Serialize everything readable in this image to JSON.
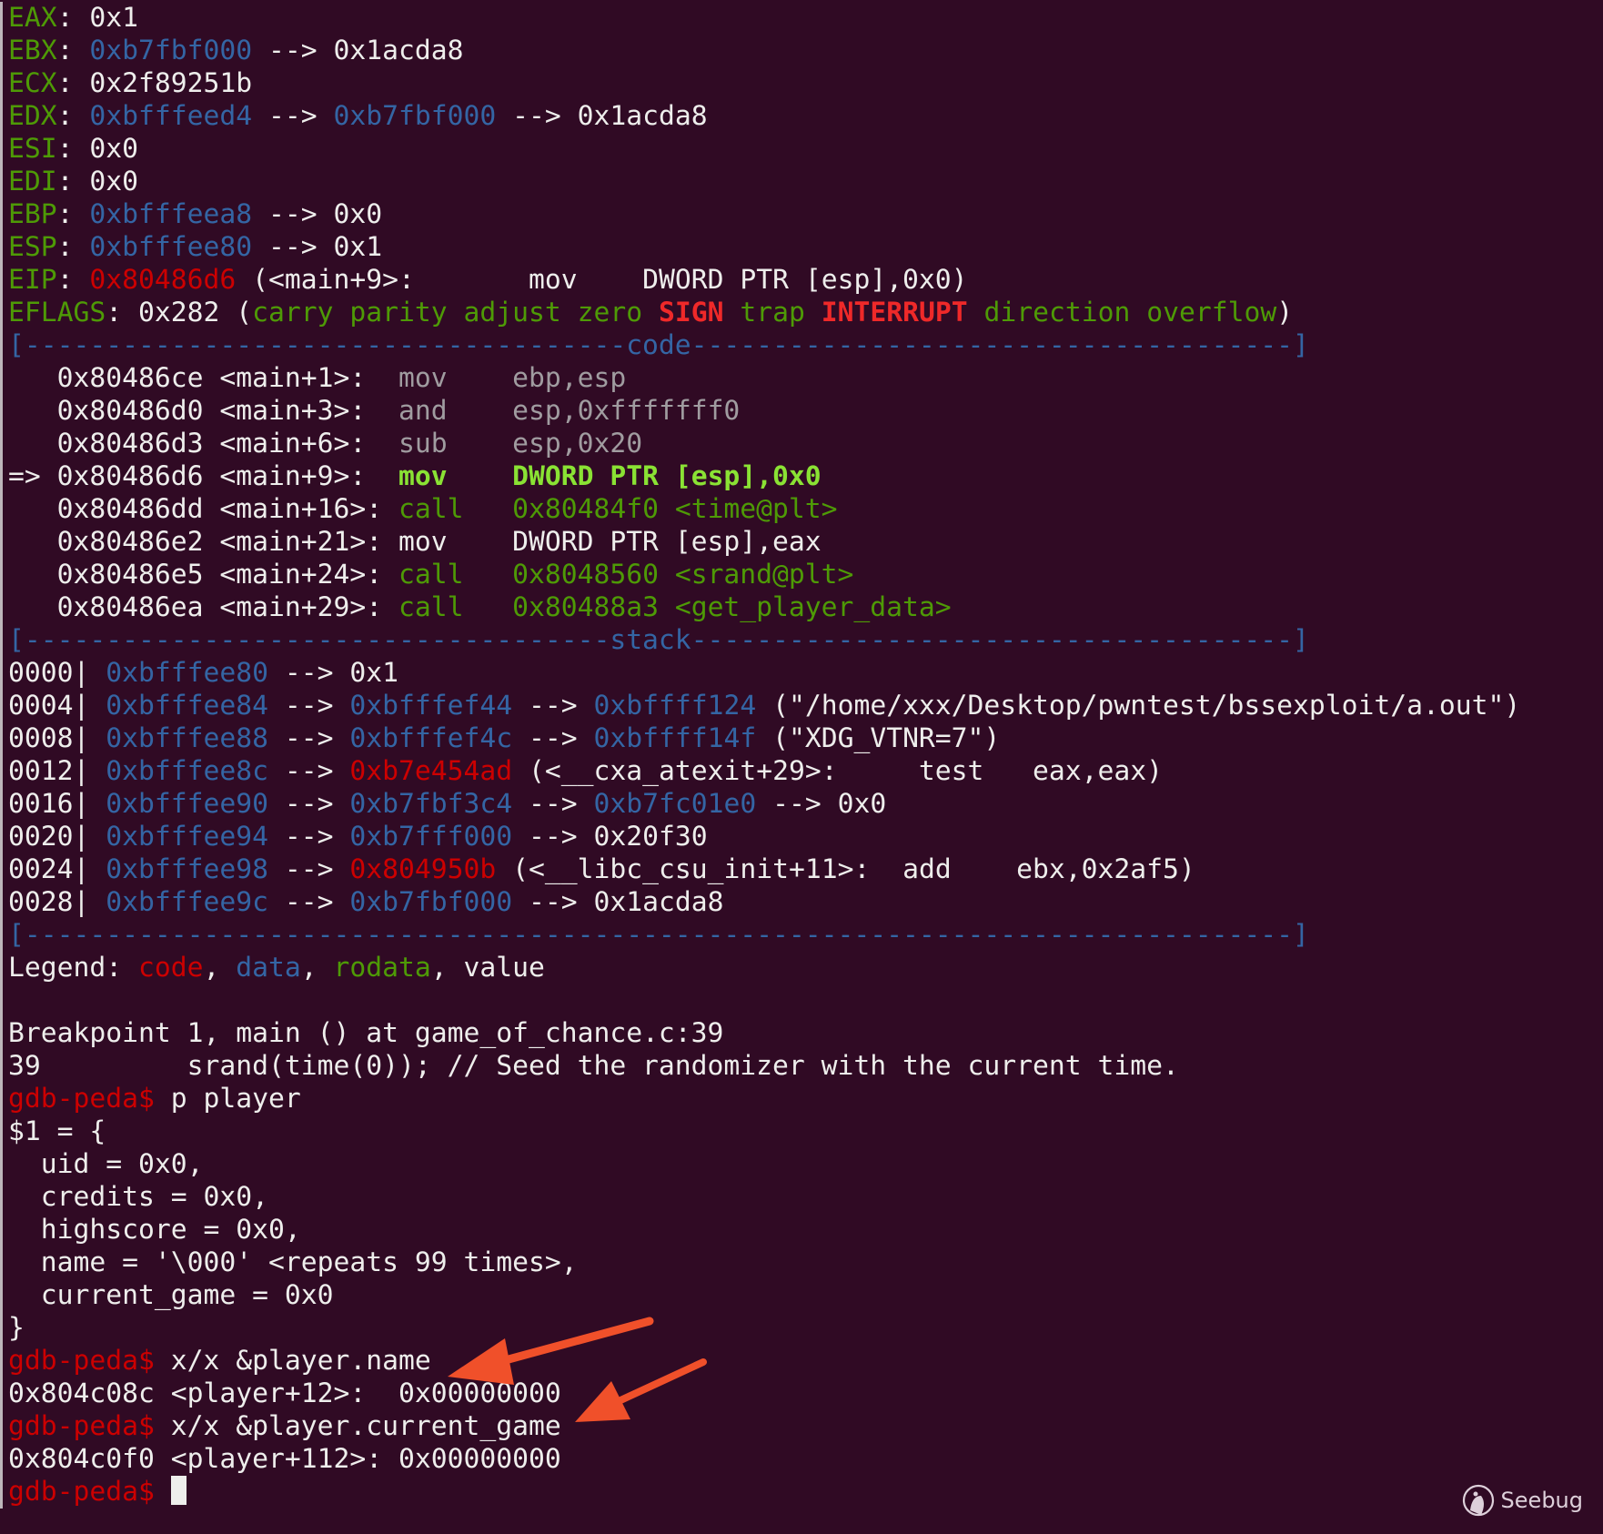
{
  "colors": {
    "background": "#300a24",
    "green": "#4e9a06",
    "blue": "#3465a4",
    "red": "#cc0000",
    "bright_red": "#ef2929",
    "bright_green": "#8ae234",
    "white": "#eeeeec",
    "arrow": "#f0502a"
  },
  "sections": [
    {
      "name": "registers-panel",
      "lines": [
        [
          {
            "t": "EAX",
            "c": "g"
          },
          {
            "t": ": 0x1",
            "c": "w"
          }
        ],
        [
          {
            "t": "EBX",
            "c": "g"
          },
          {
            "t": ": ",
            "c": "w"
          },
          {
            "t": "0xb7fbf000",
            "c": "b"
          },
          {
            "t": " --> 0x1acda8",
            "c": "w"
          }
        ],
        [
          {
            "t": "ECX",
            "c": "g"
          },
          {
            "t": ": 0x2f89251b",
            "c": "w"
          }
        ],
        [
          {
            "t": "EDX",
            "c": "g"
          },
          {
            "t": ": ",
            "c": "w"
          },
          {
            "t": "0xbfffeed4",
            "c": "b"
          },
          {
            "t": " --> ",
            "c": "w"
          },
          {
            "t": "0xb7fbf000",
            "c": "b"
          },
          {
            "t": " --> 0x1acda8",
            "c": "w"
          }
        ],
        [
          {
            "t": "ESI",
            "c": "g"
          },
          {
            "t": ": 0x0",
            "c": "w"
          }
        ],
        [
          {
            "t": "EDI",
            "c": "g"
          },
          {
            "t": ": 0x0",
            "c": "w"
          }
        ],
        [
          {
            "t": "EBP",
            "c": "g"
          },
          {
            "t": ": ",
            "c": "w"
          },
          {
            "t": "0xbfffeea8",
            "c": "b"
          },
          {
            "t": " --> 0x0",
            "c": "w"
          }
        ],
        [
          {
            "t": "ESP",
            "c": "g"
          },
          {
            "t": ": ",
            "c": "w"
          },
          {
            "t": "0xbfffee80",
            "c": "b"
          },
          {
            "t": " --> 0x1",
            "c": "w"
          }
        ],
        [
          {
            "t": "EIP",
            "c": "g"
          },
          {
            "t": ": ",
            "c": "w"
          },
          {
            "t": "0x80486d6",
            "c": "r"
          },
          {
            "t": " (<main+9>:       mov    DWORD PTR [esp],0x0)",
            "c": "w"
          }
        ],
        [
          {
            "t": "EFLAGS",
            "c": "g"
          },
          {
            "t": ": 0x282 (",
            "c": "w"
          },
          {
            "t": "carry parity adjust zero ",
            "c": "g"
          },
          {
            "t": "SIGN",
            "c": "R"
          },
          {
            "t": " trap ",
            "c": "g"
          },
          {
            "t": "INTERRUPT",
            "c": "R"
          },
          {
            "t": " direction overflow",
            "c": "g"
          },
          {
            "t": ")",
            "c": "w"
          }
        ]
      ]
    },
    {
      "name": "code-panel",
      "lines": [
        [
          {
            "t": "[-------------------------------------code-------------------------------------]",
            "c": "s"
          }
        ],
        [
          {
            "t": "   0x80486ce <main+1>:  ",
            "c": "w"
          },
          {
            "t": "mov    ebp,esp",
            "c": "d"
          }
        ],
        [
          {
            "t": "   0x80486d0 <main+3>:  ",
            "c": "w"
          },
          {
            "t": "and    esp,0xfffffff0",
            "c": "d"
          }
        ],
        [
          {
            "t": "   0x80486d3 <main+6>:  ",
            "c": "w"
          },
          {
            "t": "sub    esp,0x20",
            "c": "d"
          }
        ],
        [
          {
            "t": "=> 0x80486d6 <main+9>:  ",
            "c": "w"
          },
          {
            "t": "mov    DWORD PTR [esp],0x0",
            "c": "G"
          }
        ],
        [
          {
            "t": "   0x80486dd <main+16>: ",
            "c": "w"
          },
          {
            "t": "call   0x80484f0 <time@plt>",
            "c": "g"
          }
        ],
        [
          {
            "t": "   0x80486e2 <main+21>: mov    DWORD PTR [esp],eax",
            "c": "w"
          }
        ],
        [
          {
            "t": "   0x80486e5 <main+24>: ",
            "c": "w"
          },
          {
            "t": "call   0x8048560 <srand@plt>",
            "c": "g"
          }
        ],
        [
          {
            "t": "   0x80486ea <main+29>: ",
            "c": "w"
          },
          {
            "t": "call   0x80488a3 <get_player_data>",
            "c": "g"
          }
        ]
      ]
    },
    {
      "name": "stack-panel",
      "lines": [
        [
          {
            "t": "[------------------------------------stack-------------------------------------]",
            "c": "s"
          }
        ],
        [
          {
            "t": "0000| ",
            "c": "w"
          },
          {
            "t": "0xbfffee80",
            "c": "b"
          },
          {
            "t": " --> 0x1",
            "c": "w"
          }
        ],
        [
          {
            "t": "0004| ",
            "c": "w"
          },
          {
            "t": "0xbfffee84",
            "c": "b"
          },
          {
            "t": " --> ",
            "c": "w"
          },
          {
            "t": "0xbfffef44",
            "c": "b"
          },
          {
            "t": " --> ",
            "c": "w"
          },
          {
            "t": "0xbffff124",
            "c": "b"
          },
          {
            "t": " (\"/home/xxx/Desktop/pwntest/bssexploit/a.out\")",
            "c": "w"
          }
        ],
        [
          {
            "t": "0008| ",
            "c": "w"
          },
          {
            "t": "0xbfffee88",
            "c": "b"
          },
          {
            "t": " --> ",
            "c": "w"
          },
          {
            "t": "0xbfffef4c",
            "c": "b"
          },
          {
            "t": " --> ",
            "c": "w"
          },
          {
            "t": "0xbffff14f",
            "c": "b"
          },
          {
            "t": " (\"XDG_VTNR=7\")",
            "c": "w"
          }
        ],
        [
          {
            "t": "0012| ",
            "c": "w"
          },
          {
            "t": "0xbfffee8c",
            "c": "b"
          },
          {
            "t": " --> ",
            "c": "w"
          },
          {
            "t": "0xb7e454ad",
            "c": "r"
          },
          {
            "t": " (<__cxa_atexit+29>:     test   eax,eax)",
            "c": "w"
          }
        ],
        [
          {
            "t": "0016| ",
            "c": "w"
          },
          {
            "t": "0xbfffee90",
            "c": "b"
          },
          {
            "t": " --> ",
            "c": "w"
          },
          {
            "t": "0xb7fbf3c4",
            "c": "b"
          },
          {
            "t": " --> ",
            "c": "w"
          },
          {
            "t": "0xb7fc01e0",
            "c": "b"
          },
          {
            "t": " --> 0x0",
            "c": "w"
          }
        ],
        [
          {
            "t": "0020| ",
            "c": "w"
          },
          {
            "t": "0xbfffee94",
            "c": "b"
          },
          {
            "t": " --> ",
            "c": "w"
          },
          {
            "t": "0xb7fff000",
            "c": "b"
          },
          {
            "t": " --> 0x20f30",
            "c": "w"
          }
        ],
        [
          {
            "t": "0024| ",
            "c": "w"
          },
          {
            "t": "0xbfffee98",
            "c": "b"
          },
          {
            "t": " --> ",
            "c": "w"
          },
          {
            "t": "0x804950b",
            "c": "r"
          },
          {
            "t": " (<__libc_csu_init+11>:  add    ebx,0x2af5)",
            "c": "w"
          }
        ],
        [
          {
            "t": "0028| ",
            "c": "w"
          },
          {
            "t": "0xbfffee9c",
            "c": "b"
          },
          {
            "t": " --> ",
            "c": "w"
          },
          {
            "t": "0xb7fbf000",
            "c": "b"
          },
          {
            "t": " --> 0x1acda8",
            "c": "w"
          }
        ],
        [
          {
            "t": "[------------------------------------------------------------------------------]",
            "c": "s"
          }
        ]
      ]
    },
    {
      "name": "legend",
      "lines": [
        [
          {
            "t": "Legend: ",
            "c": "w"
          },
          {
            "t": "code",
            "c": "r"
          },
          {
            "t": ", ",
            "c": "w"
          },
          {
            "t": "data",
            "c": "b"
          },
          {
            "t": ", ",
            "c": "w"
          },
          {
            "t": "rodata",
            "c": "g"
          },
          {
            "t": ", value",
            "c": "w"
          }
        ],
        [
          {
            "t": " ",
            "c": "w"
          }
        ]
      ]
    },
    {
      "name": "gdb-session",
      "lines": [
        [
          {
            "t": "Breakpoint 1, main () at game_of_chance.c:39",
            "c": "w"
          }
        ],
        [
          {
            "t": "39         srand(time(0)); // Seed the randomizer with the current time.",
            "c": "w"
          }
        ],
        [
          {
            "t": "gdb-peda$ ",
            "c": "r"
          },
          {
            "t": "p player",
            "c": "w"
          }
        ],
        [
          {
            "t": "$1 = {",
            "c": "w"
          }
        ],
        [
          {
            "t": "  uid = 0x0,",
            "c": "w"
          }
        ],
        [
          {
            "t": "  credits = 0x0,",
            "c": "w"
          }
        ],
        [
          {
            "t": "  highscore = 0x0,",
            "c": "w"
          }
        ],
        [
          {
            "t": "  name = '\\000' <repeats 99 times>,",
            "c": "w"
          }
        ],
        [
          {
            "t": "  current_game = 0x0",
            "c": "w"
          }
        ],
        [
          {
            "t": "}",
            "c": "w"
          }
        ],
        [
          {
            "t": "gdb-peda$ ",
            "c": "r"
          },
          {
            "t": "x/x &player.name",
            "c": "w"
          }
        ],
        [
          {
            "t": "0x804c08c <player+12>:  0x00000000",
            "c": "w"
          }
        ],
        [
          {
            "t": "gdb-peda$ ",
            "c": "r"
          },
          {
            "t": "x/x &player.current_game",
            "c": "w"
          }
        ],
        [
          {
            "t": "0x804c0f0 <player+112>: 0x00000000",
            "c": "w"
          }
        ],
        [
          {
            "t": "gdb-peda$ ",
            "c": "r"
          }
        ]
      ]
    }
  ],
  "watermark": {
    "text": "Seebug",
    "icon": "seebug-ladybug-icon"
  }
}
